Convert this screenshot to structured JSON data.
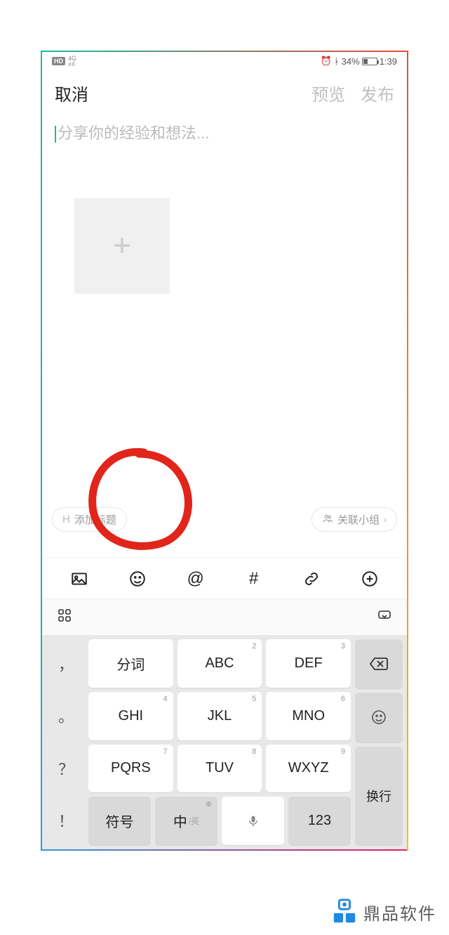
{
  "status": {
    "hd": "HD",
    "net": "4G",
    "alarm_icon": "alarm",
    "bt_icon": "bluetooth",
    "battery_pct": "34%",
    "time": "1:39"
  },
  "nav": {
    "cancel": "取消",
    "preview": "预览",
    "publish": "发布"
  },
  "editor": {
    "placeholder": "分享你的经验和想法..."
  },
  "tags": {
    "add_title_prefix": "H",
    "add_title": "添加标题",
    "link_group_icon": "people",
    "link_group": "关联小组",
    "chevron": "›"
  },
  "toolbar": {
    "image": "image",
    "emoji": "emoji",
    "at": "@",
    "hash": "#",
    "link": "link",
    "add": "add"
  },
  "kbcontrol": {
    "apps": "apps",
    "hide": "hide-keyboard"
  },
  "keyboard": {
    "left_punct": [
      "，",
      "。",
      "？",
      "！"
    ],
    "rows": [
      [
        "分词",
        "ABC",
        "DEF"
      ],
      [
        "GHI",
        "JKL",
        "MNO"
      ],
      [
        "PQRS",
        "TUV",
        "WXYZ"
      ],
      [
        "符号",
        "中",
        "mic",
        "123"
      ]
    ],
    "row3_sub": "/英",
    "right": {
      "backspace": "⌫",
      "emoji": "☺",
      "enter": "换行"
    }
  },
  "watermark": {
    "text": "鼎品软件"
  }
}
